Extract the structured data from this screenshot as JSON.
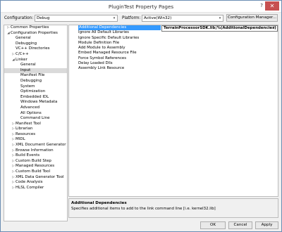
{
  "window": {
    "title": "PluginTest Property Pages",
    "help_glyph": "?",
    "close_glyph": "✕"
  },
  "config_bar": {
    "configuration_label": "Configuration:",
    "configuration_value": "Debug",
    "platform_label": "Platform:",
    "platform_value": "Active(Win32)",
    "manager_button": "Configuration Manager..."
  },
  "tree": [
    {
      "label": "Common Properties",
      "level": 0,
      "expander": "▷"
    },
    {
      "label": "Configuration Properties",
      "level": 0,
      "expander": "◢"
    },
    {
      "label": "General",
      "level": 1,
      "expander": ""
    },
    {
      "label": "Debugging",
      "level": 1,
      "expander": ""
    },
    {
      "label": "VC++ Directories",
      "level": 1,
      "expander": ""
    },
    {
      "label": "C/C++",
      "level": 1,
      "expander": "▷"
    },
    {
      "label": "Linker",
      "level": 1,
      "expander": "◢"
    },
    {
      "label": "General",
      "level": 2,
      "expander": ""
    },
    {
      "label": "Input",
      "level": 2,
      "expander": "",
      "selected": true
    },
    {
      "label": "Manifest File",
      "level": 2,
      "expander": ""
    },
    {
      "label": "Debugging",
      "level": 2,
      "expander": ""
    },
    {
      "label": "System",
      "level": 2,
      "expander": ""
    },
    {
      "label": "Optimization",
      "level": 2,
      "expander": ""
    },
    {
      "label": "Embedded IDL",
      "level": 2,
      "expander": ""
    },
    {
      "label": "Windows Metadata",
      "level": 2,
      "expander": ""
    },
    {
      "label": "Advanced",
      "level": 2,
      "expander": ""
    },
    {
      "label": "All Options",
      "level": 2,
      "expander": ""
    },
    {
      "label": "Command Line",
      "level": 2,
      "expander": ""
    },
    {
      "label": "Manifest Tool",
      "level": 1,
      "expander": "▷"
    },
    {
      "label": "Librarian",
      "level": 1,
      "expander": "▷"
    },
    {
      "label": "Resources",
      "level": 1,
      "expander": "▷"
    },
    {
      "label": "MIDL",
      "level": 1,
      "expander": "▷"
    },
    {
      "label": "XML Document Generator",
      "level": 1,
      "expander": "▷"
    },
    {
      "label": "Browse Information",
      "level": 1,
      "expander": "▷"
    },
    {
      "label": "Build Events",
      "level": 1,
      "expander": "▷"
    },
    {
      "label": "Custom Build Step",
      "level": 1,
      "expander": "▷"
    },
    {
      "label": "Managed Resources",
      "level": 1,
      "expander": "▷"
    },
    {
      "label": "Custom Build Tool",
      "level": 1,
      "expander": "▷"
    },
    {
      "label": "XML Data Generator Tool",
      "level": 1,
      "expander": "▷"
    },
    {
      "label": "Code Analysis",
      "level": 1,
      "expander": "▷"
    },
    {
      "label": "HLSL Compiler",
      "level": 1,
      "expander": "▷"
    }
  ],
  "properties": [
    {
      "name": "Additional Dependencies",
      "value": "TerrainProcessorSDK.lib;%(AdditionalDependencies)",
      "selected": true
    },
    {
      "name": "Ignore All Default Libraries",
      "value": ""
    },
    {
      "name": "Ignore Specific Default Libraries",
      "value": ""
    },
    {
      "name": "Module Definition File",
      "value": ""
    },
    {
      "name": "Add Module to Assembly",
      "value": ""
    },
    {
      "name": "Embed Managed Resource File",
      "value": ""
    },
    {
      "name": "Force Symbol References",
      "value": ""
    },
    {
      "name": "Delay Loaded Dlls",
      "value": ""
    },
    {
      "name": "Assembly Link Resource",
      "value": ""
    }
  ],
  "description": {
    "title": "Additional Dependencies",
    "text": "Specifies additional items to add to the link command line [i.e. kernel32.lib]"
  },
  "buttons": {
    "ok": "OK",
    "cancel": "Cancel",
    "apply": "Apply"
  },
  "colors": {
    "selection": "#3399ff",
    "close": "#c75050",
    "window_border": "#6b8db3"
  },
  "icons": {
    "dropdown": "▾"
  }
}
